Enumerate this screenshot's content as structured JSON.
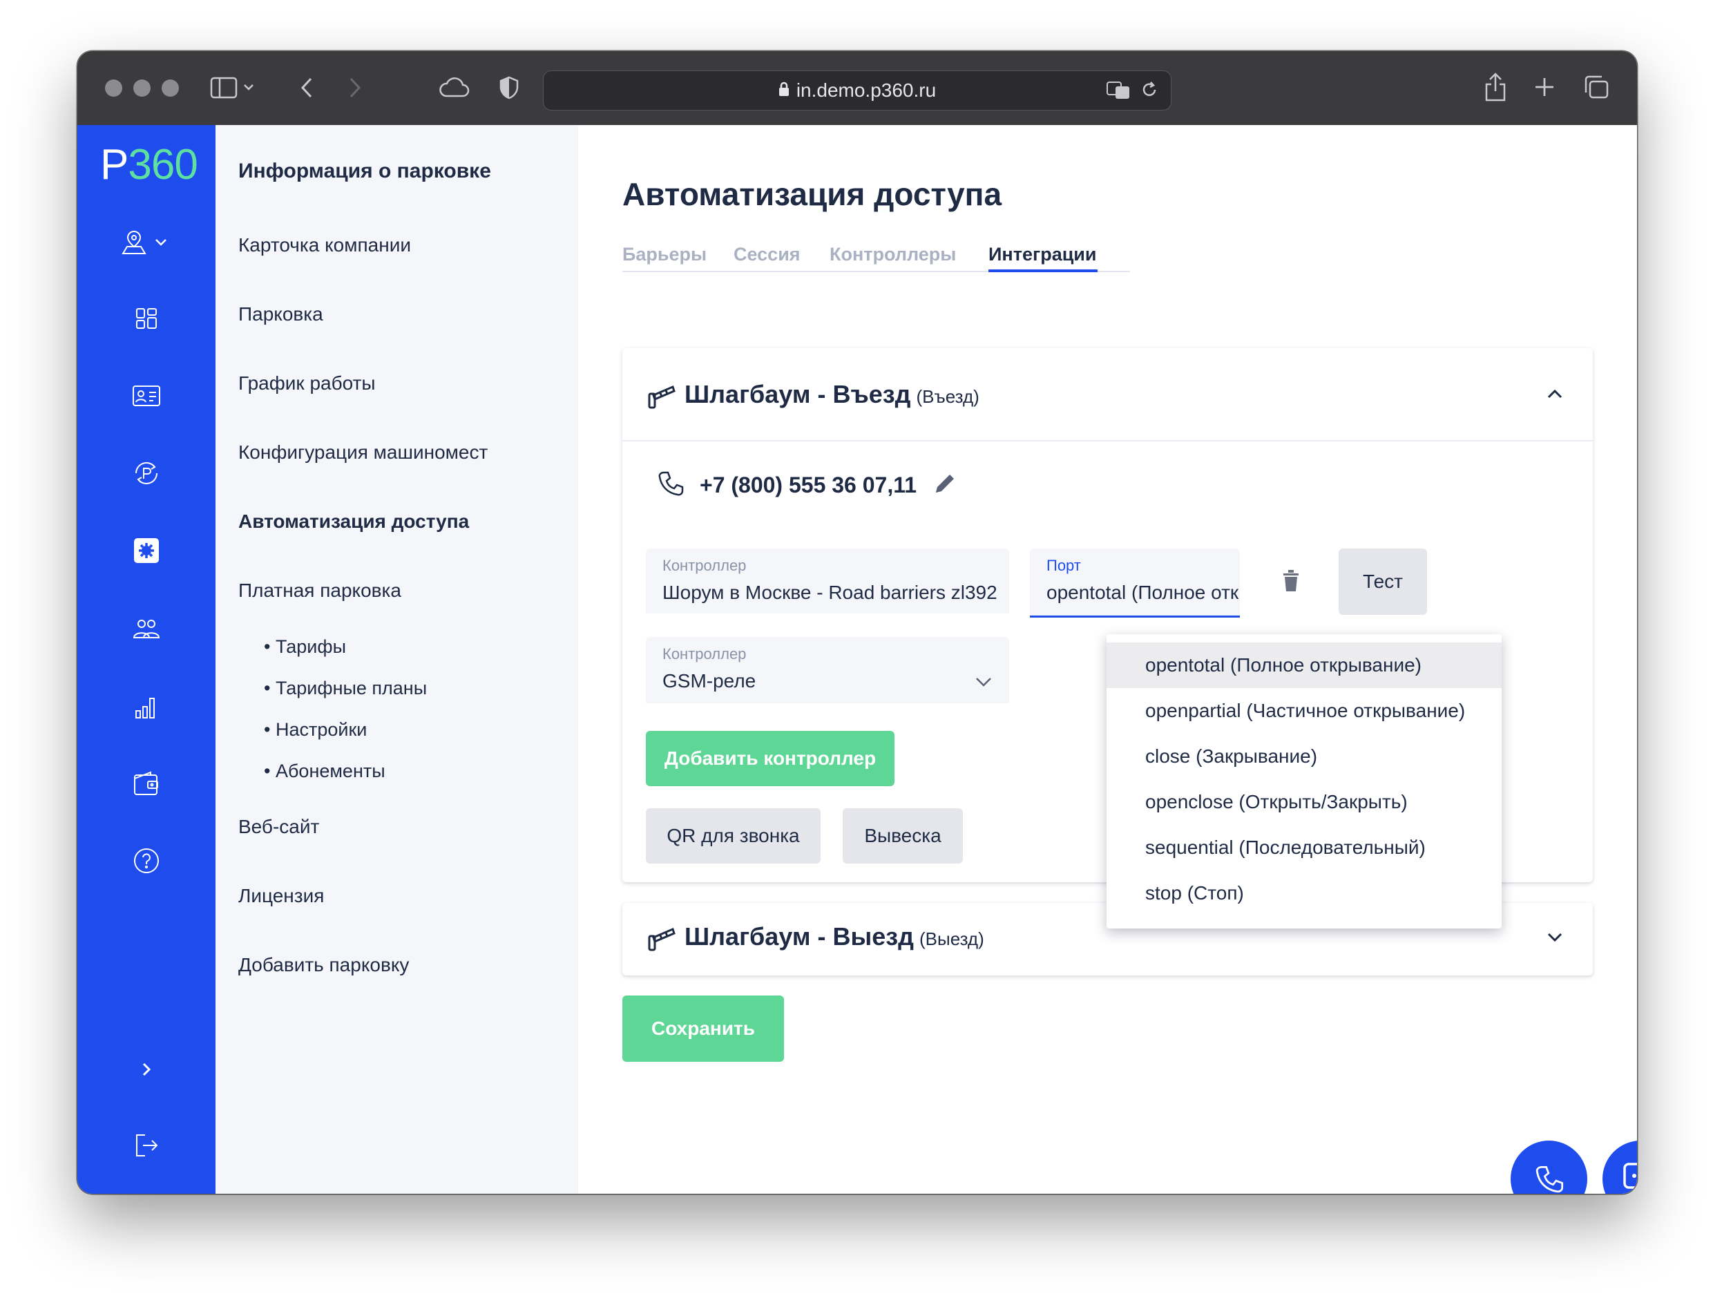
{
  "browser": {
    "url": "in.demo.p360.ru"
  },
  "brand": {
    "logo_p": "P",
    "logo_n": "360"
  },
  "rail_icons": [
    "location-icon",
    "dashboard-icon",
    "id-card-icon",
    "parking-cycle-icon",
    "settings-icon",
    "users-icon",
    "stats-icon",
    "wallet-icon",
    "help-icon",
    "expand-icon",
    "logout-icon"
  ],
  "subnav": {
    "header": "Информация о парковке",
    "items": [
      "Карточка компании",
      "Парковка",
      "График работы",
      "Конфигурация машиномест",
      "Автоматизация доступа",
      "Платная парковка"
    ],
    "paid_sub": [
      "• Тарифы",
      "• Тарифные планы",
      "• Настройки",
      "• Абонементы"
    ],
    "bottom_items": [
      "Веб-сайт",
      "Лицензия",
      "Добавить парковку"
    ]
  },
  "page": {
    "title": "Автоматизация доступа",
    "tabs": [
      "Барьеры",
      "Сессия",
      "Контроллеры",
      "Интеграции"
    ],
    "active_tab": "Интеграции"
  },
  "entry_card": {
    "title": "Шлагбаум - Въезд",
    "subtitle": "(Въезд)",
    "phone": "+7 (800) 555 36 07,11",
    "controller1": {
      "label": "Контроллер",
      "value": "Шорум в Москве - Road barriers zl392 ("
    },
    "port": {
      "label": "Порт",
      "value": "opentotal (Полное отк"
    },
    "test_label": "Тест",
    "controller2": {
      "label": "Контроллер",
      "value": "GSM-реле"
    },
    "add_controller": "Добавить контроллер",
    "qr_label": "QR для звонка",
    "sign_label": "Вывеска"
  },
  "port_options": [
    "opentotal (Полное открывание)",
    "openpartial (Частичное открывание)",
    "close (Закрывание)",
    "openclose (Открыть/Закрыть)",
    "sequential (Последовательный)",
    "stop (Стоп)"
  ],
  "exit_card": {
    "title": "Шлагбаум - Выезд",
    "subtitle": "(Выезд)"
  },
  "save_label": "Сохранить",
  "colors": {
    "brand_blue": "#1f4ded",
    "green": "#5ed696",
    "logo_green": "#5ee0a0"
  }
}
